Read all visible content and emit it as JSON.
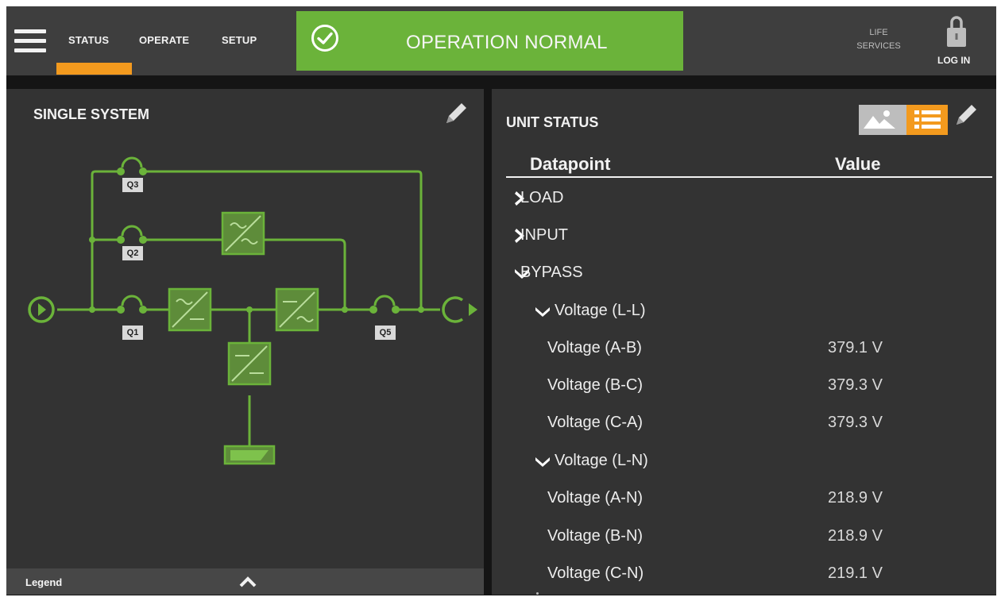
{
  "header": {
    "nav": [
      "STATUS",
      "OPERATE",
      "SETUP"
    ],
    "active_tab": "STATUS",
    "status": "OPERATION NORMAL",
    "life_services": [
      "LIFE",
      "SERVICES"
    ],
    "login": "LOG IN",
    "accent_color": "#f39a1e",
    "status_color": "#6bb33a"
  },
  "single_system": {
    "title": "SINGLE SYSTEM",
    "breakers": [
      "Q3",
      "Q2",
      "Q1",
      "Q5"
    ],
    "diagram_color": "#6bb33a",
    "legend": "Legend"
  },
  "unit_status": {
    "title": "UNIT STATUS",
    "col_datapoint": "Datapoint",
    "col_value": "Value",
    "rows": [
      {
        "label": "LOAD",
        "value": "",
        "level": 0,
        "expanded": false
      },
      {
        "label": "INPUT",
        "value": "",
        "level": 0,
        "expanded": false
      },
      {
        "label": "BYPASS",
        "value": "",
        "level": 0,
        "expanded": true
      },
      {
        "label": "Voltage (L-L)",
        "value": "",
        "level": 1,
        "expanded": true
      },
      {
        "label": "Voltage (A-B)",
        "value": "379.1 V",
        "level": 2
      },
      {
        "label": "Voltage (B-C)",
        "value": "379.3 V",
        "level": 2
      },
      {
        "label": "Voltage (C-A)",
        "value": "379.3 V",
        "level": 2
      },
      {
        "label": "Voltage (L-N)",
        "value": "",
        "level": 1,
        "expanded": true
      },
      {
        "label": "Voltage (A-N)",
        "value": "218.9 V",
        "level": 2
      },
      {
        "label": "Voltage (B-N)",
        "value": "218.9 V",
        "level": 2
      },
      {
        "label": "Voltage (C-N)",
        "value": "219.1 V",
        "level": 2
      }
    ]
  }
}
